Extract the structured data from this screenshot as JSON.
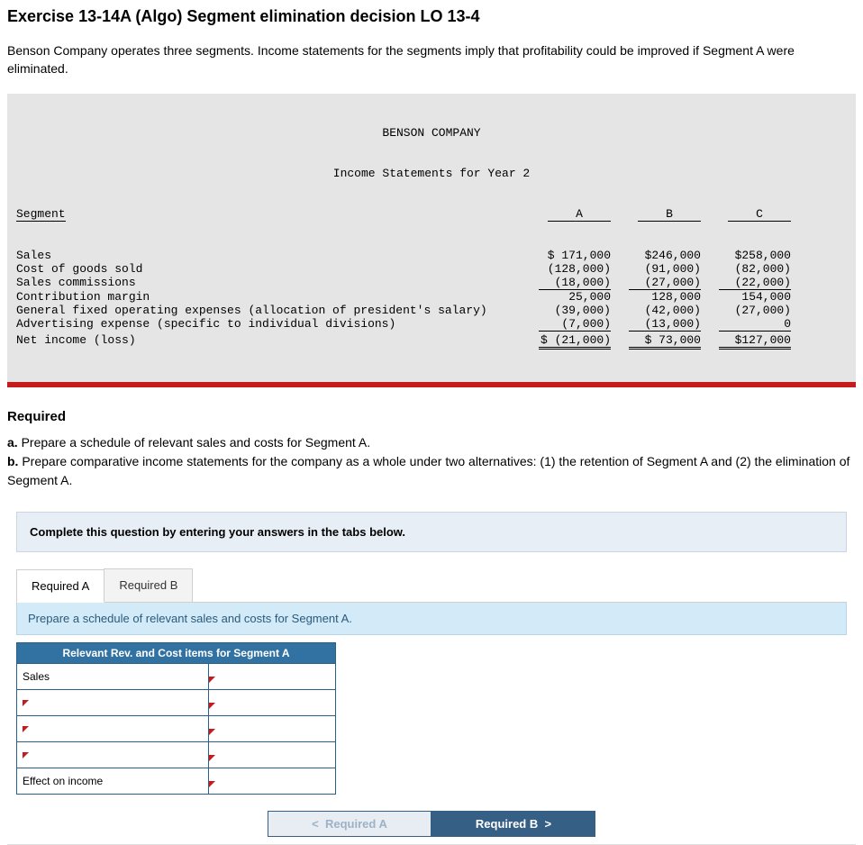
{
  "title": "Exercise 13-14A (Algo) Segment elimination decision LO 13-4",
  "intro": "Benson Company operates three segments. Income statements for the segments imply that profitability could be improved if Segment A were eliminated.",
  "stmt": {
    "company": "BENSON COMPANY",
    "subtitle": "Income Statements for Year 2",
    "head": {
      "seg": "Segment",
      "a": "A",
      "b": "B",
      "c": "C"
    },
    "rows": [
      {
        "label": "Sales",
        "a": "$ 171,000",
        "b": "$246,000",
        "c": "$258,000"
      },
      {
        "label": "Cost of goods sold",
        "a": "(128,000)",
        "b": "(91,000)",
        "c": "(82,000)"
      },
      {
        "label": "Sales commissions",
        "a": "(18,000)",
        "b": "(27,000)",
        "c": "(22,000)",
        "underline": true
      },
      {
        "label": "Contribution margin",
        "a": "25,000",
        "b": "128,000",
        "c": "154,000"
      },
      {
        "label": "General fixed operating expenses (allocation of president's salary)",
        "a": "(39,000)",
        "b": "(42,000)",
        "c": "(27,000)"
      },
      {
        "label": "Advertising expense (specific to individual divisions)",
        "a": "(7,000)",
        "b": "(13,000)",
        "c": "0",
        "underline": true
      },
      {
        "label": "Net income (loss)",
        "a": "$ (21,000)",
        "b": "$ 73,000",
        "c": "$127,000",
        "double": true
      }
    ]
  },
  "required": {
    "heading": "Required",
    "a_label": "a.",
    "a_text": "Prepare a schedule of relevant sales and costs for Segment A.",
    "b_label": "b.",
    "b_text": "Prepare comparative income statements for the company as a whole under two alternatives: (1) the retention of Segment A and (2) the elimination of Segment A."
  },
  "instruction": "Complete this question by entering your answers in the tabs below.",
  "tabs": {
    "a": "Required A",
    "b": "Required B"
  },
  "tab_instruction": "Prepare a schedule of relevant sales and costs for Segment A.",
  "answer": {
    "header": "Relevant Rev. and Cost items for Segment A",
    "rows": [
      "Sales",
      "",
      "",
      "",
      "Effect on income"
    ]
  },
  "nav": {
    "prev": "Required A",
    "next": "Required B"
  },
  "chart_data": {
    "type": "table",
    "title": "BENSON COMPANY — Income Statements for Year 2",
    "columns": [
      "Segment",
      "A",
      "B",
      "C"
    ],
    "rows": [
      [
        "Sales",
        171000,
        246000,
        258000
      ],
      [
        "Cost of goods sold",
        -128000,
        -91000,
        -82000
      ],
      [
        "Sales commissions",
        -18000,
        -27000,
        -22000
      ],
      [
        "Contribution margin",
        25000,
        128000,
        154000
      ],
      [
        "General fixed operating expenses (allocation of president's salary)",
        -39000,
        -42000,
        -27000
      ],
      [
        "Advertising expense (specific to individual divisions)",
        -7000,
        -13000,
        0
      ],
      [
        "Net income (loss)",
        -21000,
        73000,
        127000
      ]
    ]
  }
}
